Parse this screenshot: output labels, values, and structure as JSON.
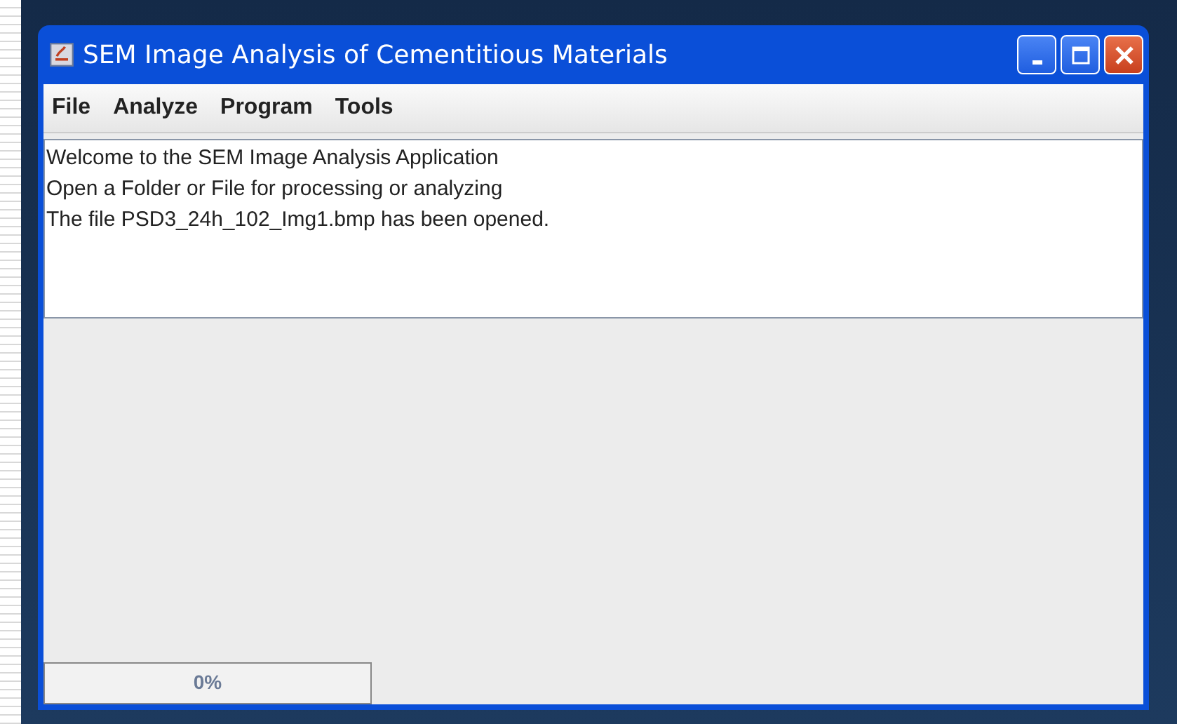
{
  "window": {
    "title": "SEM Image Analysis of Cementitious Materials"
  },
  "menu": [
    {
      "label": "File"
    },
    {
      "label": "Analyze"
    },
    {
      "label": "Program"
    },
    {
      "label": "Tools"
    }
  ],
  "log": [
    "Welcome to the SEM Image Analysis Application",
    "Open a Folder or File for processing or analyzing",
    "The file PSD3_24h_102_Img1.bmp has been opened."
  ],
  "progress": {
    "reading": "0%"
  }
}
